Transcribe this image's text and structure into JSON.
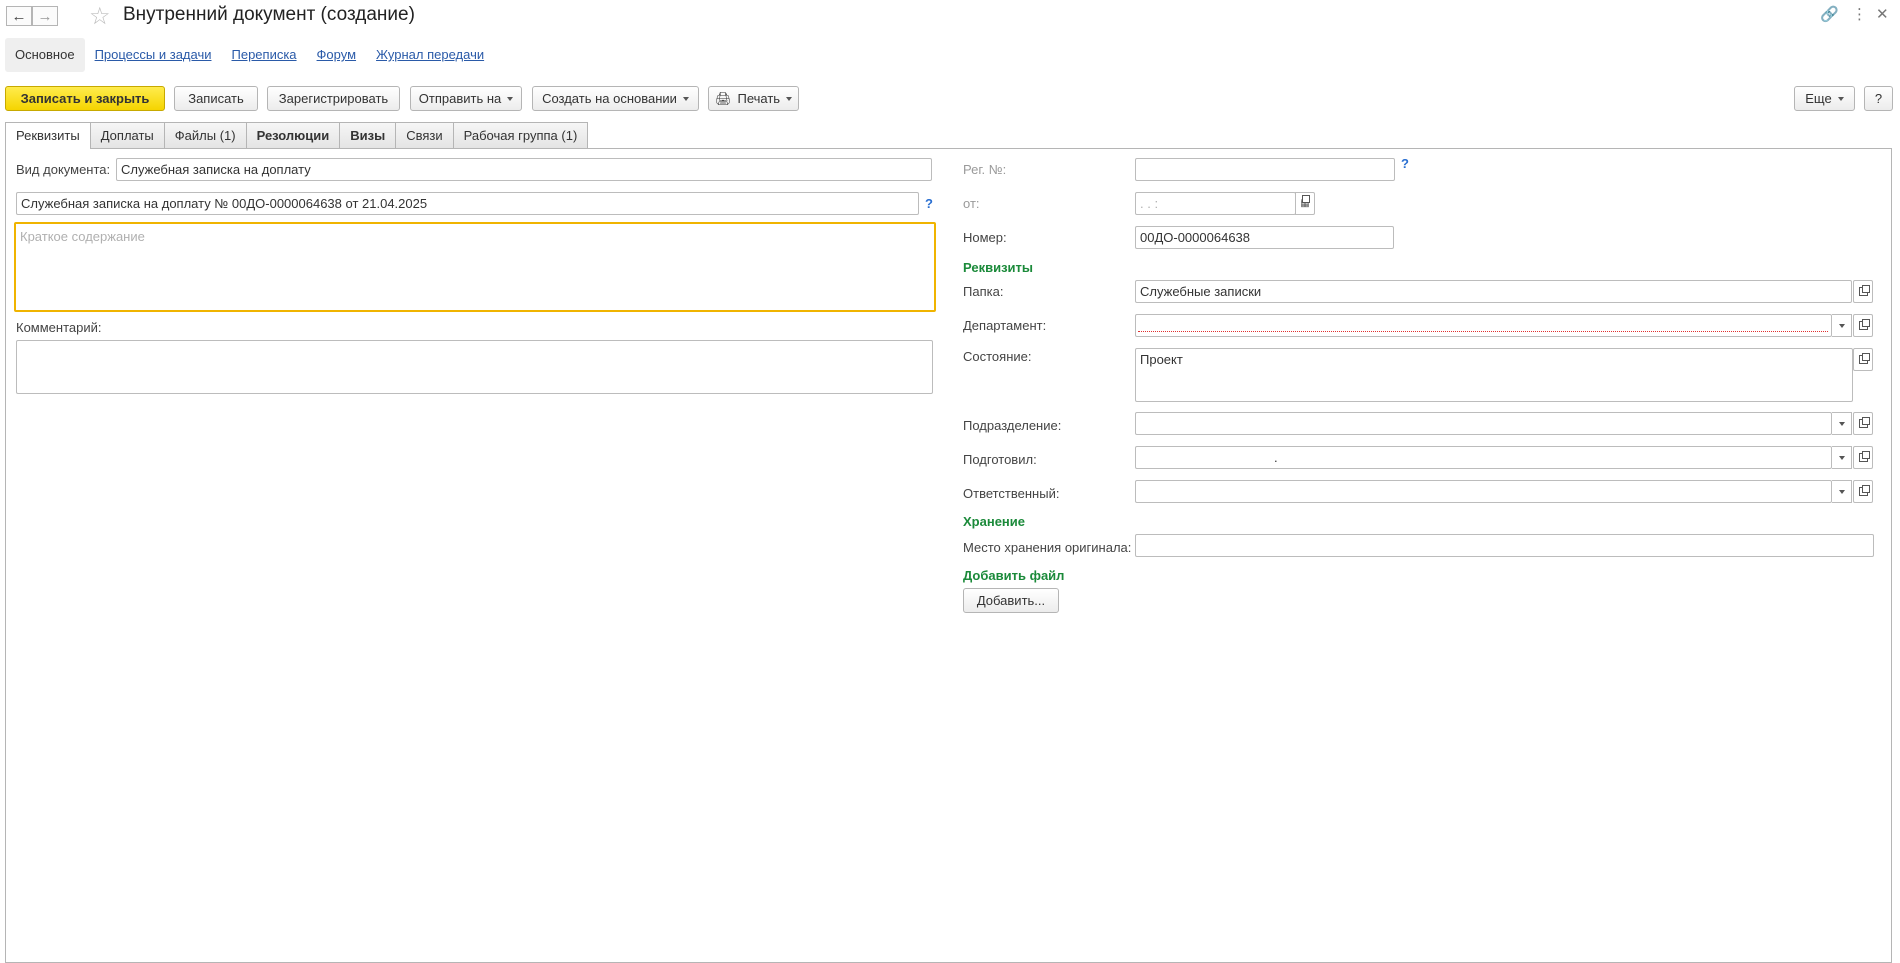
{
  "window": {
    "title": "Внутренний документ (создание)",
    "back_icon": "arrow-left-icon",
    "forward_icon": "arrow-right-icon"
  },
  "sections": [
    {
      "label": "Основное",
      "active": true
    },
    {
      "label": "Процессы и задачи"
    },
    {
      "label": "Переписка"
    },
    {
      "label": "Форум"
    },
    {
      "label": "Журнал передачи"
    }
  ],
  "toolbar": {
    "save_close": "Записать и закрыть",
    "save": "Записать",
    "register": "Зарегистрировать",
    "send_to": "Отправить на",
    "create_based": "Создать на основании",
    "print": "Печать",
    "more": "Еще",
    "help": "?"
  },
  "tabs": [
    {
      "label": "Реквизиты",
      "active": true
    },
    {
      "label": "Доплаты"
    },
    {
      "label": "Файлы (1)"
    },
    {
      "label": "Резолюции",
      "bold": true
    },
    {
      "label": "Визы",
      "bold": true
    },
    {
      "label": "Связи"
    },
    {
      "label": "Рабочая группа (1)"
    }
  ],
  "left": {
    "doc_type_label": "Вид документа:",
    "doc_type_value": "Служебная записка на доплату",
    "doc_title": "Служебная записка на доплату № 00ДО-0000064638 от 21.04.2025",
    "help": "?",
    "summary_placeholder": "Краткое содержание",
    "comment_label": "Комментарий:"
  },
  "right": {
    "reg_no_label": "Рег. №:",
    "reg_help": "?",
    "from_label": "от:",
    "from_value": ".  .      :",
    "number_label": "Номер:",
    "number_value": "00ДО-0000064638",
    "group_requisites": "Реквизиты",
    "folder_label": "Папка:",
    "folder_value": "Служебные записки",
    "department_label": "Департамент:",
    "state_label": "Состояние:",
    "state_value": "Проект",
    "subdivision_label": "Подразделение:",
    "prepared_label": "Подготовил:",
    "prepared_value": ".",
    "responsible_label": "Ответственный:",
    "group_storage": "Хранение",
    "storage_label": "Место хранения оригинала:",
    "group_add_file": "Добавить файл",
    "add_button": "Добавить..."
  },
  "colors": {
    "primary_button": "#f5d400",
    "link": "#2a5aa8",
    "group_header": "#1b8a3a",
    "focus_border": "#f0b400"
  }
}
